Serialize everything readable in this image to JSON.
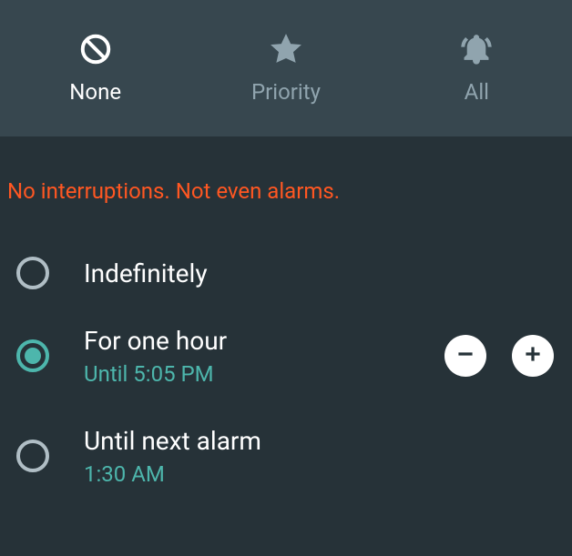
{
  "tabs": {
    "none": {
      "label": "None",
      "active": true
    },
    "priority": {
      "label": "Priority",
      "active": false
    },
    "all": {
      "label": "All",
      "active": false
    }
  },
  "warning": "No interruptions. Not even alarms.",
  "options": {
    "indefinitely": {
      "label": "Indefinitely"
    },
    "for_one_hour": {
      "label": "For one hour",
      "sub": "Until 5:05 PM",
      "selected": true
    },
    "until_next_alarm": {
      "label": "Until next alarm",
      "sub": "1:30 AM"
    }
  }
}
